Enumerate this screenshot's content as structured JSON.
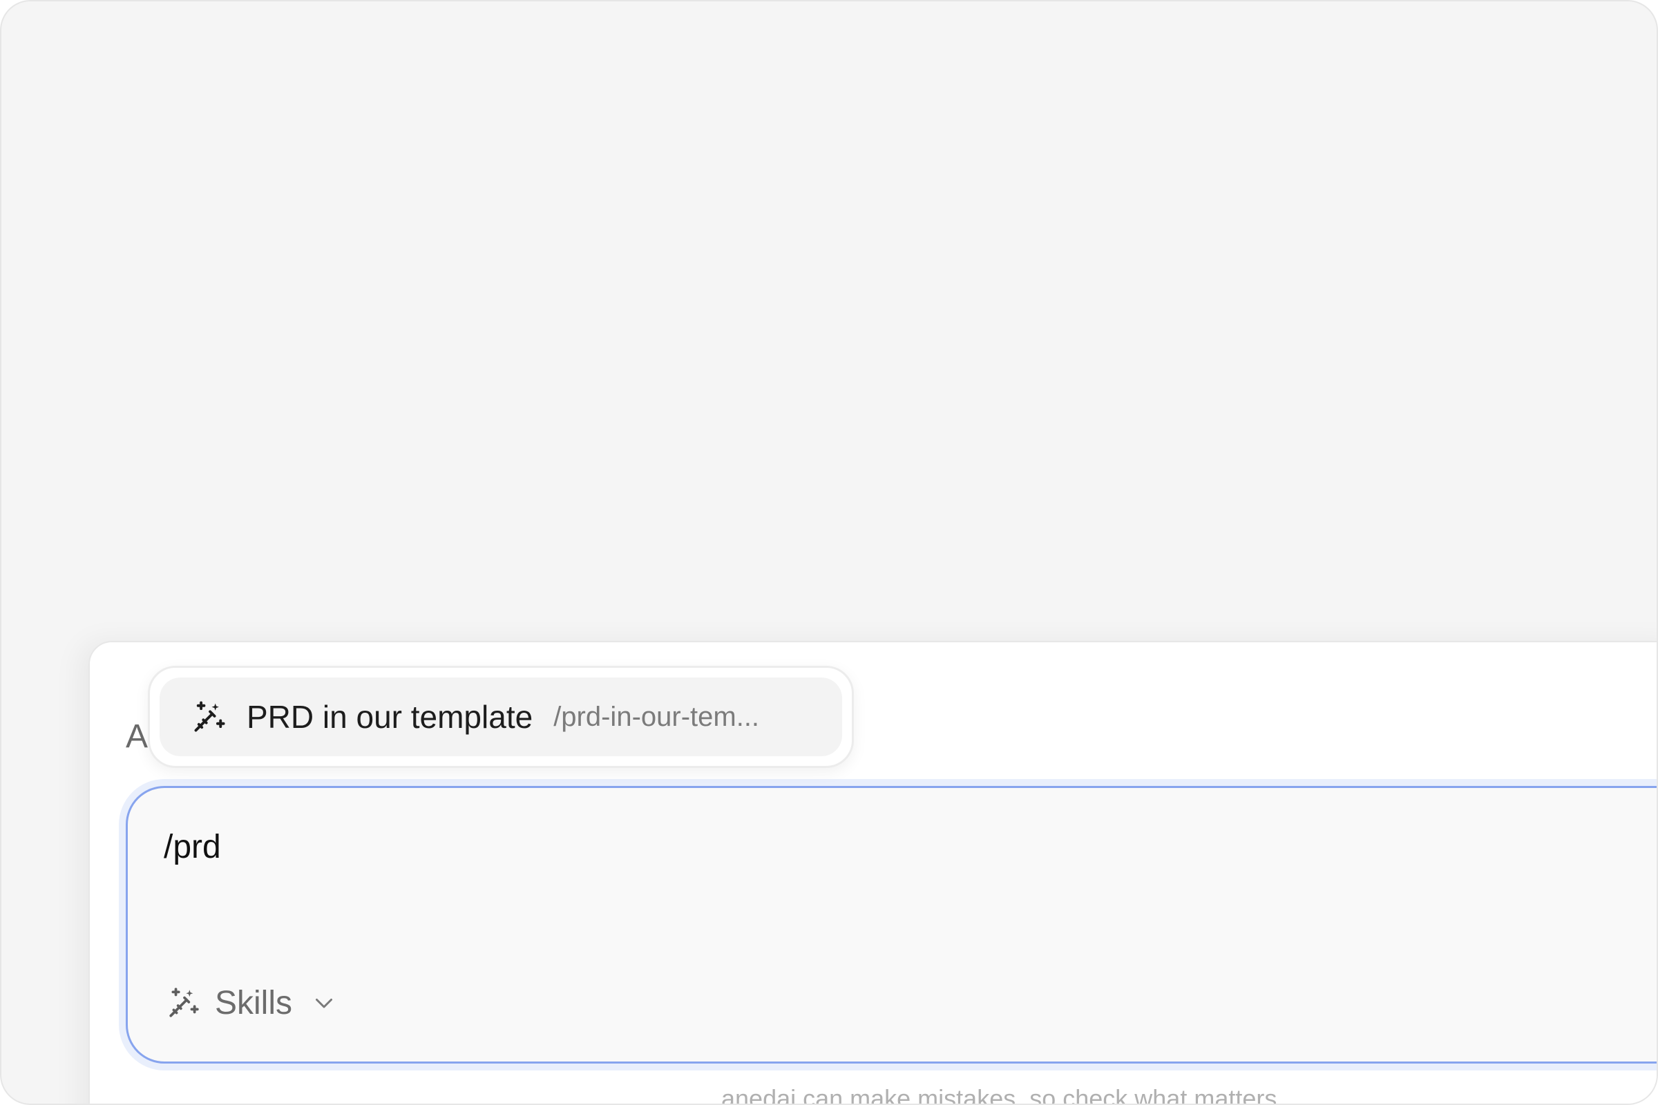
{
  "composer": {
    "heading_partial": "A",
    "input_value": "/prd",
    "skills_label": "Skills",
    "disclaimer": "anedai can make mistakes, so check what matters"
  },
  "suggestion": {
    "title": "PRD in our template",
    "slug": "/prd-in-our-tem..."
  },
  "icons": {
    "suggestion_icon": "magic-wand-icon",
    "skills_icon": "magic-wand-icon",
    "skills_dropdown": "chevron-down-icon"
  },
  "colors": {
    "focus_border": "#87a4ee",
    "background": "#f5f5f5",
    "panel": "#ffffff"
  }
}
